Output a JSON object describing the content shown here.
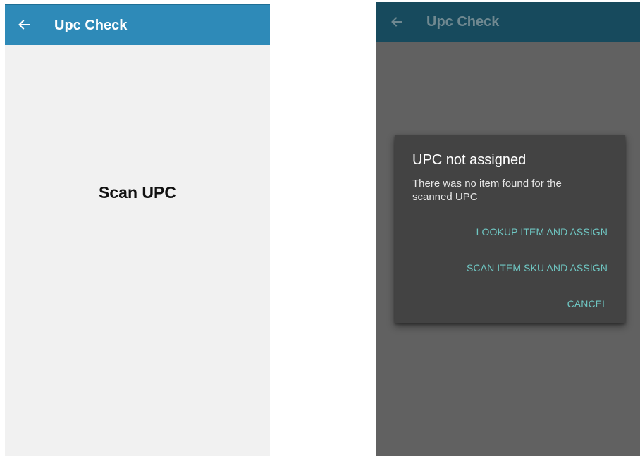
{
  "left_screen": {
    "appbar": {
      "back_icon": "arrow-left-icon",
      "title": "Upc Check"
    },
    "body": {
      "prompt": "Scan UPC"
    }
  },
  "right_screen": {
    "appbar": {
      "back_icon": "arrow-left-icon",
      "title": "Upc Check"
    },
    "dialog": {
      "title": "UPC not assigned",
      "message": "There was no item found for the scanned UPC",
      "buttons": [
        {
          "label": "LOOKUP ITEM AND ASSIGN"
        },
        {
          "label": "SCAN ITEM SKU AND ASSIGN"
        },
        {
          "label": "CANCEL"
        }
      ]
    }
  },
  "colors": {
    "appbar_active": "#2e8ab8",
    "appbar_dimmed": "#174a5d",
    "screen_background": "#f1f1f1",
    "scrim": "#616161",
    "dialog_background": "#434343",
    "dialog_button": "#6fc7c3"
  }
}
